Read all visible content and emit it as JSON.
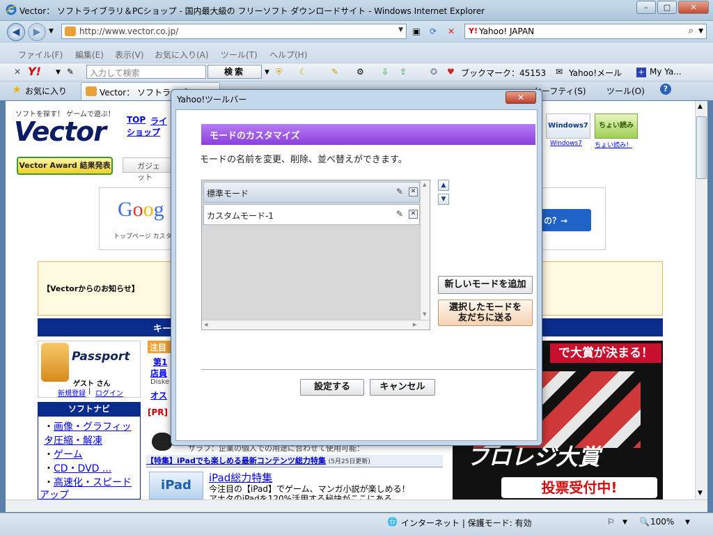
{
  "window": {
    "title": "Vector： ソフトライブラリ＆PCショップ - 国内最大級の フリーソフト ダウンロードサイト - Windows Internet Explorer",
    "min": "–",
    "max": "□",
    "close": "✕"
  },
  "address": {
    "url": "http://www.vector.co.jp/"
  },
  "search": {
    "provider": "Yahoo! JAPAN"
  },
  "menu": [
    "ファイル(F)",
    "編集(E)",
    "表示(V)",
    "お気に入り(A)",
    "ツール(T)",
    "ヘルプ(H)"
  ],
  "ytoolbar": {
    "search_placeholder": "入力して検索",
    "search_button": "検索",
    "bookmarks": "ブックマーク：45153",
    "mail": "Yahoo!メール",
    "myyahoo": "My Ya..."
  },
  "tabs": {
    "favorites": "お気に入り",
    "tab1": "Vector： ソフトライブラリ",
    "safety": "セーフティ(S)",
    "tools": "ツール(O)"
  },
  "page": {
    "tagline": "ソフトを探す！ ゲームで遊ぶ！",
    "logo": "Vector",
    "nav1": "TOP",
    "nav2": "ライ",
    "nav3": "ショップ",
    "award": "Vector Award 結果発表",
    "gadget": "ガジェット",
    "google_sub": "トップページ カスタ",
    "google_btn": "の？→",
    "win7": "Windows7",
    "chotto": "ちょい読み！",
    "notice": "【Vectorからのお知らせ】",
    "bluebar": "キー",
    "passport_guest": "ゲスト さん",
    "register": "新規登録",
    "login": "ログイン",
    "softnavi": "ソフトナビ",
    "nav_items": [
      "画像・グラフィック",
      "圧縮・解凍",
      "ゲーム",
      "CD・DVD ...",
      "高速化・スピード",
      "アップ"
    ],
    "feature_head": "【特集】iPadでも楽しめる最新コンテンツ総力特集",
    "feature_date": "(5月25日更新)",
    "ipad_title": "iPad総力特集",
    "ipad_desc1": "今注目の【iPad】でゲーム、マンガ小説が楽しめる！",
    "ipad_desc2": "アナタのiPadを120%活用する秘訣がここにある",
    "banner_top": "で大賞が決まる！",
    "banner_mid": "フロレジ大賞",
    "banner_bottom": "投票受付中!",
    "pr": "[PR]",
    "ad_text": "サラフ：企業の個人での用途に合わせて使用可能：",
    "chumoku": "注目",
    "dai": "第1",
    "tenin": "店員",
    "disk": "Diske",
    "osu": "オス"
  },
  "status": {
    "zone": "インターネット | 保護モード: 有効",
    "zoom": "100%"
  },
  "dialog": {
    "title": "Yahoo!ツールバー",
    "close": "✕",
    "header": "モードのカスタマイズ",
    "description": "モードの名前を変更、削除、並べ替えができます。",
    "modes": [
      "標準モード",
      "カスタムモード-1"
    ],
    "add_mode": "新しいモードを追加",
    "share_mode_line1": "選択したモードを",
    "share_mode_line2": "友だちに送る",
    "ok": "設定する",
    "cancel": "キャンセル"
  }
}
